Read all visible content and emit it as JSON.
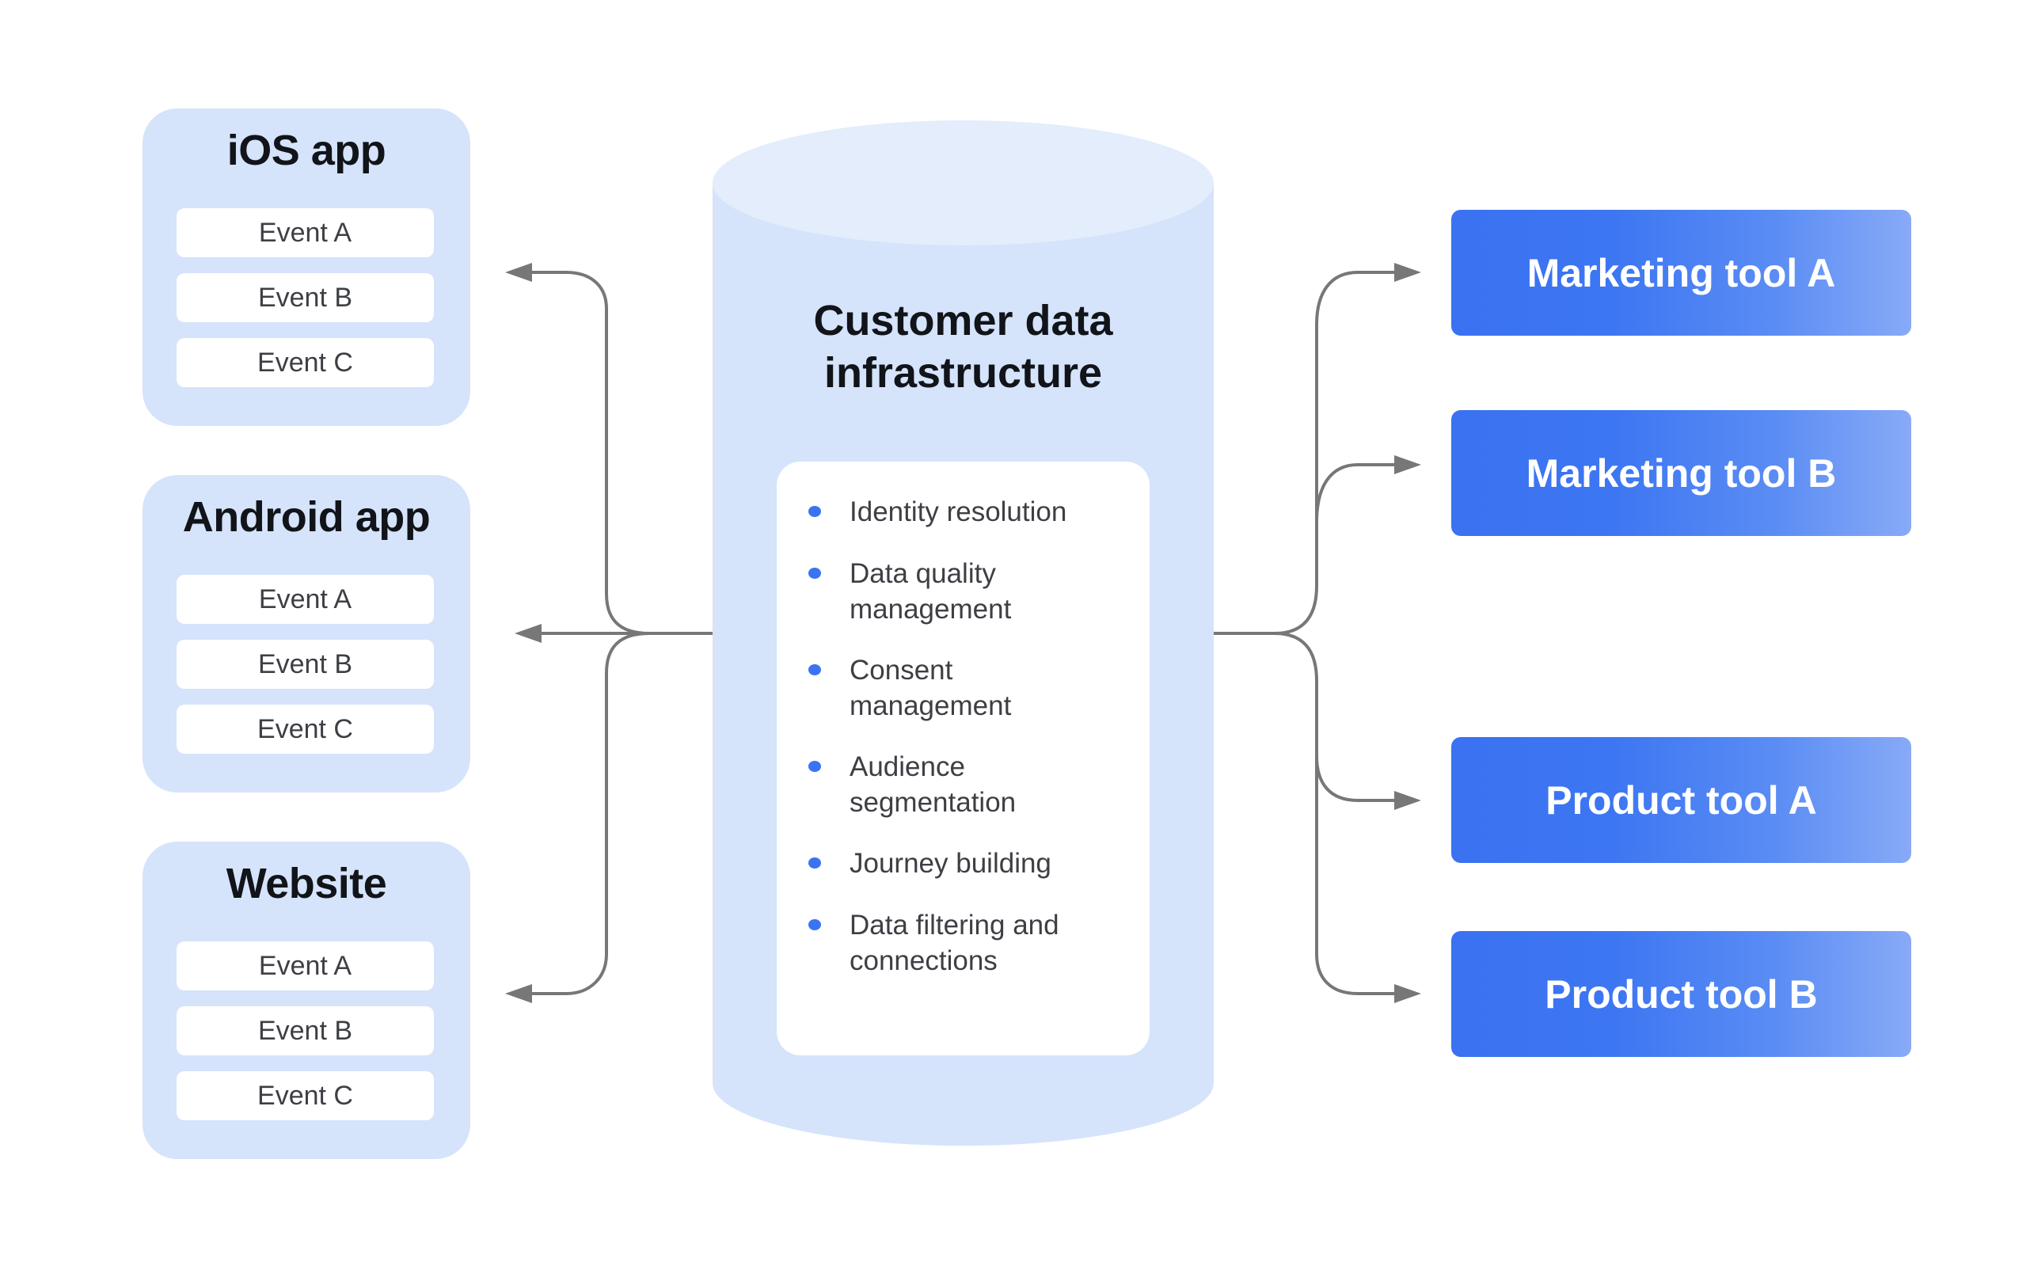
{
  "sources": [
    {
      "title": "iOS app",
      "events": [
        "Event A",
        "Event B",
        "Event C"
      ]
    },
    {
      "title": "Android app",
      "events": [
        "Event A",
        "Event B",
        "Event C"
      ]
    },
    {
      "title": "Website",
      "events": [
        "Event A",
        "Event B",
        "Event C"
      ]
    }
  ],
  "hub": {
    "title_line1": "Customer data",
    "title_line2": "infrastructure",
    "capabilities": [
      {
        "line1": "Identity resolution",
        "line2": ""
      },
      {
        "line1": "Data quality",
        "line2": "management"
      },
      {
        "line1": "Consent",
        "line2": "management"
      },
      {
        "line1": "Audience",
        "line2": "segmentation"
      },
      {
        "line1": "Journey building",
        "line2": ""
      },
      {
        "line1": "Data filtering and",
        "line2": "connections"
      }
    ]
  },
  "destinations": [
    {
      "label": "Marketing tool A"
    },
    {
      "label": "Marketing tool B"
    },
    {
      "label": "Product tool A"
    },
    {
      "label": "Product tool B"
    }
  ],
  "colors": {
    "source_fill": "#d5e3fb",
    "cylinder_body": "#d5e3fb",
    "cylinder_top": "#e3edfc",
    "accent_blue": "#3b74f2",
    "connector_gray": "#777777"
  }
}
